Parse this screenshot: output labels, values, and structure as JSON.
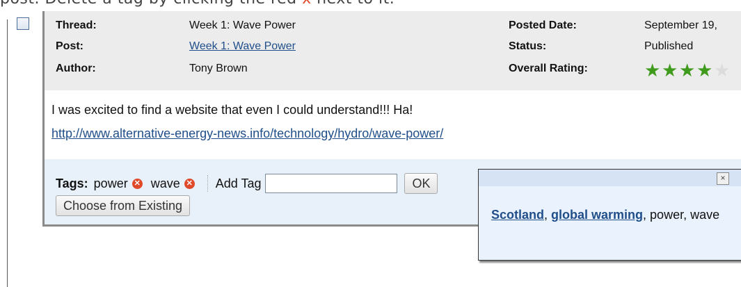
{
  "instruction": {
    "before": "post. Delete a tag by clicking the red ",
    "x": "x",
    "after": " next to it."
  },
  "meta": {
    "thread_label": "Thread:",
    "thread_value": "Week 1: Wave Power",
    "post_label": "Post:",
    "post_value": "Week 1: Wave Power",
    "author_label": "Author:",
    "author_value": "Tony Brown",
    "posted_date_label": "Posted Date:",
    "posted_date_value": "September 19,",
    "status_label": "Status:",
    "status_value": "Published",
    "overall_rating_label": "Overall Rating:",
    "rating": 4,
    "rating_max": 5
  },
  "body": {
    "text": "I was excited to find a website that even I could understand!!! Ha!",
    "link": "http://www.alternative-energy-news.info/technology/hydro/wave-power/"
  },
  "tags": {
    "label": "Tags:",
    "items": [
      "power",
      "wave"
    ],
    "add_label": "Add Tag",
    "input_value": "",
    "ok_label": "OK",
    "choose_label": "Choose from Existing"
  },
  "popup": {
    "close_glyph": "×",
    "link1": "Scotland",
    "sep1": ", ",
    "link2": "global warming",
    "rest": ", power, wave"
  },
  "colors": {
    "accent_red": "#e04a2a",
    "link_blue": "#1f4e8a",
    "star_green": "#3f9b1c"
  }
}
